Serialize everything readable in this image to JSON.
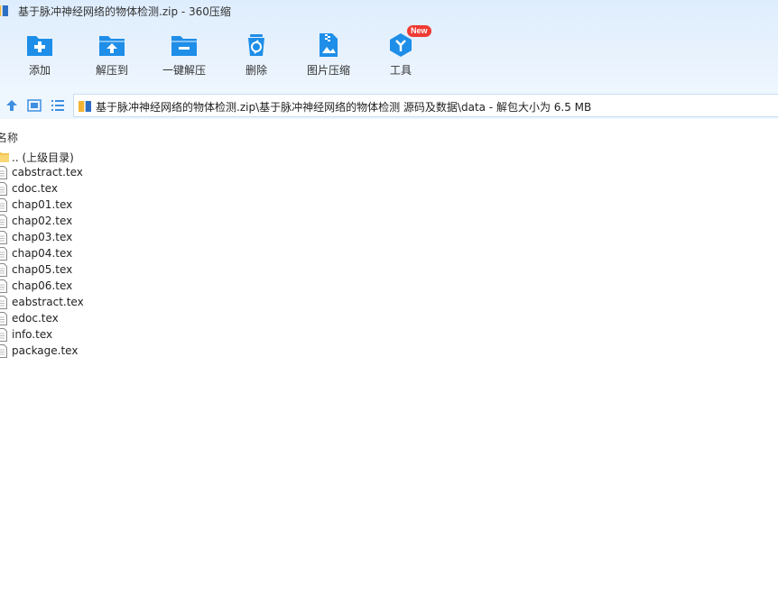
{
  "window": {
    "title": "基于脉冲神经网络的物体检测.zip - 360压缩"
  },
  "toolbar": {
    "items": [
      {
        "label": "添加",
        "icon": "add-icon"
      },
      {
        "label": "解压到",
        "icon": "extract-to-icon"
      },
      {
        "label": "一键解压",
        "icon": "one-click-extract-icon"
      },
      {
        "label": "删除",
        "icon": "delete-icon"
      },
      {
        "label": "图片压缩",
        "icon": "image-compress-icon"
      },
      {
        "label": "工具",
        "icon": "tools-icon",
        "badge": "New"
      }
    ],
    "accent_color": "#1e8ee8",
    "badge_color": "#ef3b34"
  },
  "address": {
    "path": "基于脉冲神经网络的物体检测.zip\\基于脉冲神经网络的物体检测 源码及数据\\data - 解包大小为 6.5 MB"
  },
  "list": {
    "column_name": "名称",
    "items": [
      {
        "name": ".. (上级目录)",
        "type": "folder"
      },
      {
        "name": "cabstract.tex",
        "type": "file"
      },
      {
        "name": "cdoc.tex",
        "type": "file"
      },
      {
        "name": "chap01.tex",
        "type": "file"
      },
      {
        "name": "chap02.tex",
        "type": "file"
      },
      {
        "name": "chap03.tex",
        "type": "file"
      },
      {
        "name": "chap04.tex",
        "type": "file"
      },
      {
        "name": "chap05.tex",
        "type": "file"
      },
      {
        "name": "chap06.tex",
        "type": "file"
      },
      {
        "name": "eabstract.tex",
        "type": "file"
      },
      {
        "name": "edoc.tex",
        "type": "file"
      },
      {
        "name": "info.tex",
        "type": "file"
      },
      {
        "name": "package.tex",
        "type": "file"
      }
    ]
  }
}
